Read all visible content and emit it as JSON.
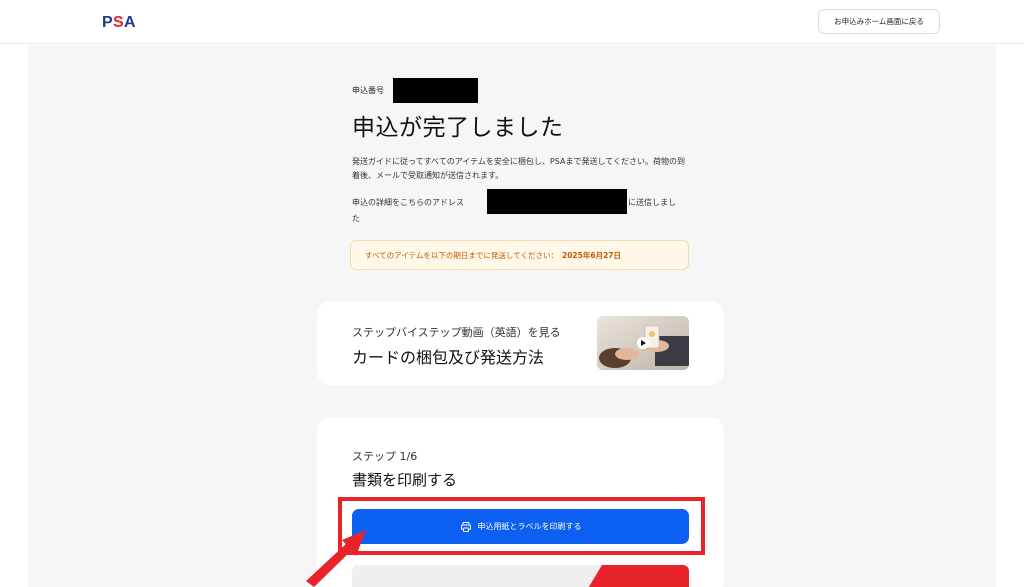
{
  "header": {
    "logo_text": "PSA",
    "back_button_label": "お申込みホーム画面に戻る"
  },
  "confirmation": {
    "application_number_label": "申込番号",
    "title": "申込が完了しました",
    "description": "発送ガイドに従ってすべてのアイテムを安全に梱包し、PSAまで発送してください。荷物の到着後、メールで受取通知が送信されます。",
    "detail_prefix": "申込の詳細をこちらのアドレス",
    "detail_suffix": "に送信しまし",
    "detail_tail": "た",
    "deadline_text": "すべてのアイテムを以下の期日までに発送してください：",
    "deadline_date": "2025年6月27日"
  },
  "video_card": {
    "subtitle": "ステップバイステップ動画（英語）を見る",
    "title": "カードの梱包及び発送方法"
  },
  "step_card": {
    "step_number": "ステップ 1/6",
    "step_title": "書類を印刷する",
    "print_button_label": "申込用紙とラベルを印刷する"
  },
  "colors": {
    "primary": "#0b5ff1",
    "highlight": "#e8232a",
    "deadline_text": "#c25a00",
    "deadline_bg": "#fff8e8"
  }
}
